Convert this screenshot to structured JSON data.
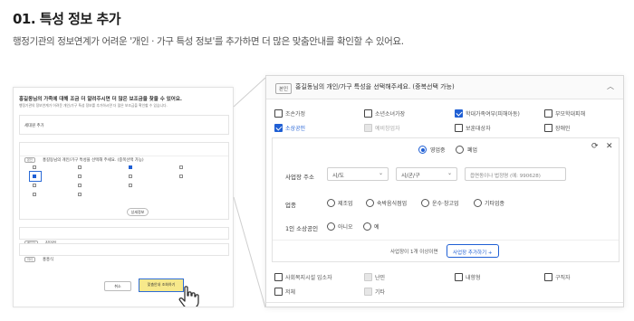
{
  "heading": "01. 특성 정보 추가",
  "subtext": "행정기관의 정보연계가 어려운 '개인 · 가구 특성 정보'를 추가하면 더 많은 맞춤안내를 확인할 수 있어요.",
  "mini": {
    "title": "홍길동님의 가족에 대해 조금 더 알려주시면 더 많은 보조금을 찾을 수 있어요.",
    "subtitle": "행정기관의 정보연계가 어려운 개인/가구 특성 정보를 추가하시면 더 많은 보조금을 확인할 수 있습니다.",
    "section1_label": "세대원 추가",
    "section2_tag": "본인",
    "section2_label": "홍길동님의 개인/가구 특성을 선택해 주세요. (중복선택 가능)",
    "detail_button": "상세정보",
    "row1_tag": "배우자",
    "row1_name": "김민정",
    "row2_tag": "자녀",
    "row2_name": "홍흥식",
    "cancel_label": "취소",
    "confirm_label": "맞춤안내 조회하기"
  },
  "panel": {
    "tag": "본인",
    "header_text": "홍길동님의 개인/가구 특성을 선택해주세요. (중복선택 가능)",
    "options_row1": [
      {
        "label": "조손가정",
        "state": "off"
      },
      {
        "label": "소년소녀가장",
        "state": "off"
      },
      {
        "label": "학대가족여부(피해아동)",
        "state": "on"
      },
      {
        "label": "부모학대피해",
        "state": "off"
      }
    ],
    "options_row2": [
      {
        "label": "소상공인",
        "state": "on"
      },
      {
        "label": "예비창업자",
        "state": "dis"
      },
      {
        "label": "보훈대상자",
        "state": "off"
      },
      {
        "label": "장애인",
        "state": "off"
      },
      {
        "label": "임산부",
        "state": "off"
      }
    ],
    "biz_type": {
      "opt1": "영업중",
      "opt2": "폐업",
      "selected": "영업중"
    },
    "address_label": "사업장 주소",
    "sido_placeholder": "시/도",
    "sigungu_placeholder": "시/군/구",
    "address_placeholder": "읍면동이나 법정명 (예: 990628)",
    "industry_label": "업종",
    "industries": [
      "제조업",
      "숙박음식점업",
      "운수·창고업",
      "기타업종"
    ],
    "solo_label": "1인 소상공인",
    "solo_opts": [
      "아니오",
      "예"
    ],
    "note": "사업장이 1개 이상이면",
    "add_button": "사업장 추가하기 +",
    "options_row3": [
      {
        "label": "사회복지시설 입소자",
        "state": "off"
      },
      {
        "label": "난민",
        "state": "dis"
      },
      {
        "label": "내향형",
        "state": "off"
      },
      {
        "label": "구직자",
        "state": "off"
      }
    ],
    "options_row4": [
      {
        "label": "저체",
        "state": "off"
      },
      {
        "label": "기타",
        "state": "dis"
      }
    ]
  }
}
